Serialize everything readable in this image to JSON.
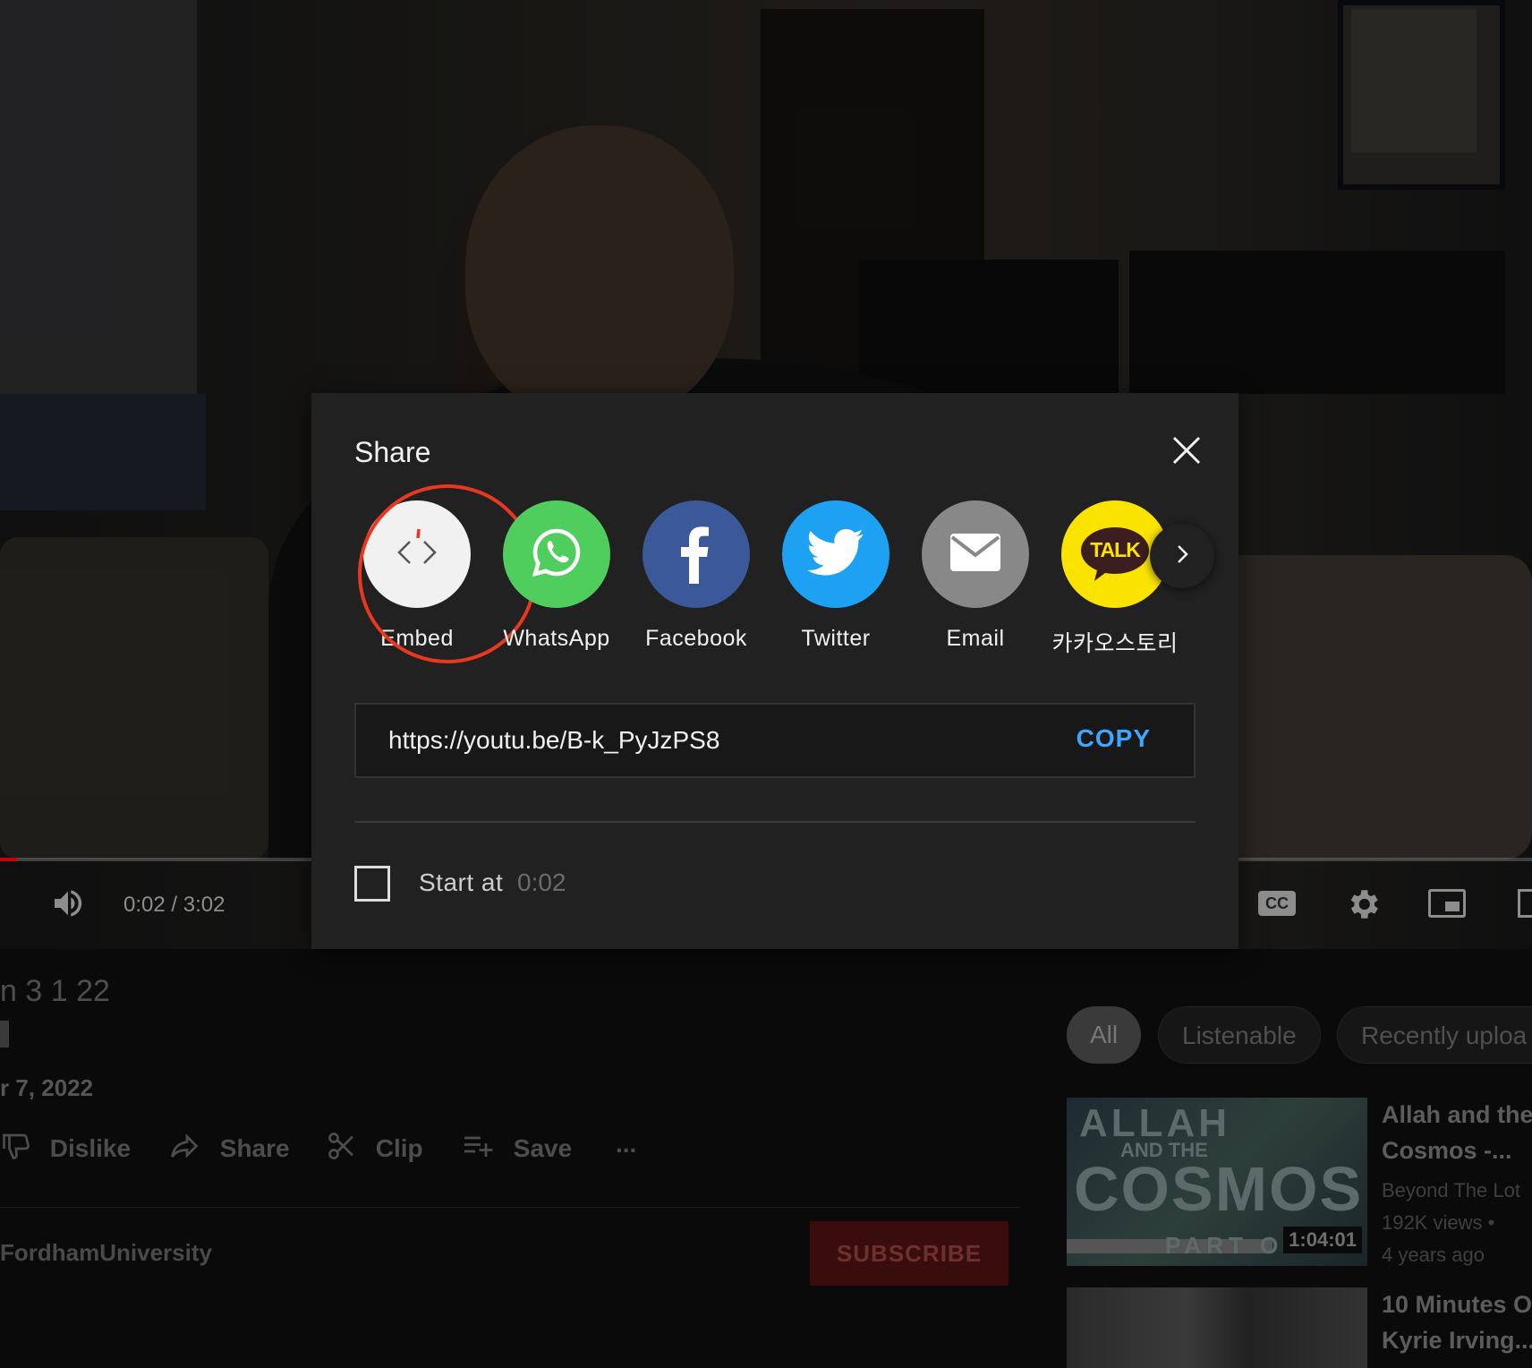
{
  "player": {
    "time": "0:02 / 3:02",
    "progress_fraction": 0.011,
    "cc_label": "CC"
  },
  "video": {
    "title": "n 3 1 22",
    "date": "r 7, 2022",
    "channel": "FordhamUniversity",
    "actions": {
      "dislike": "Dislike",
      "share": "Share",
      "clip": "Clip",
      "save": "Save",
      "more": "..."
    },
    "subscribe_label": "SUBSCRIBE"
  },
  "chips": [
    "All",
    "Listenable",
    "Recently uploa"
  ],
  "recommendations": [
    {
      "title_line1": "Allah and the",
      "title_line2": "Cosmos -...",
      "channel": "Beyond The Lot",
      "views": "192K views •",
      "age": "4 years ago",
      "duration": "1:04:01",
      "thumb_words": [
        "ALLAH",
        "AND THE",
        "COSMOS",
        "PART ON"
      ]
    },
    {
      "title_line1": "10 Minutes O",
      "title_line2": "Kyrie Irving..."
    }
  ],
  "share": {
    "title": "Share",
    "items": [
      {
        "label": "Embed",
        "icon": "embed-icon",
        "bg": "#f1f1f1"
      },
      {
        "label": "WhatsApp",
        "icon": "whatsapp-icon",
        "bg": "#4fce5d"
      },
      {
        "label": "Facebook",
        "icon": "facebook-icon",
        "bg": "#3b5998"
      },
      {
        "label": "Twitter",
        "icon": "twitter-icon",
        "bg": "#1da1f2"
      },
      {
        "label": "Email",
        "icon": "email-icon",
        "bg": "#888888"
      },
      {
        "label": "카카오스토리",
        "icon": "kakao-talk-icon",
        "bg": "#fbe300",
        "icon_text": "TALK"
      }
    ],
    "url": "https://youtu.be/B-k_PyJzPS8",
    "copy_label": "COPY",
    "start_at_label": "Start at",
    "start_at_value": "0:02",
    "highlight_color": "#e8391f",
    "accent_color": "#3ea6ff"
  }
}
